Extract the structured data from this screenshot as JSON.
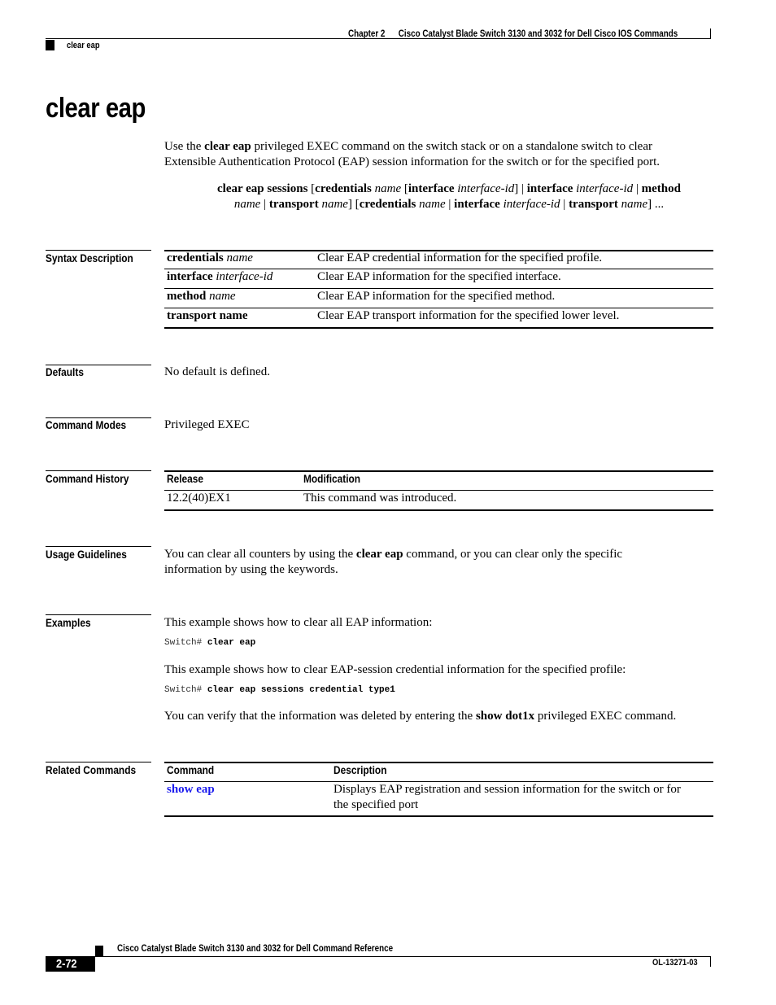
{
  "header": {
    "chapter": "Chapter 2",
    "book_section": "Cisco Catalyst Blade Switch 3130 and 3032 for Dell Cisco IOS Commands",
    "running_head": "clear eap"
  },
  "title": "clear eap",
  "intro": {
    "pre": "Use the ",
    "cmd": "clear eap",
    "post1": " privileged EXEC command on the switch stack or on a standalone switch to clear",
    "line2": "Extensible Authentication Protocol (EAP) session information for the switch or for the specified port."
  },
  "syntax": {
    "l1": [
      {
        "t": "clear eap sessions",
        "s": "b"
      },
      {
        "t": " [",
        "s": "n"
      },
      {
        "t": "credentials",
        "s": "b"
      },
      {
        "t": " name",
        "s": "i"
      },
      {
        "t": " [",
        "s": "n"
      },
      {
        "t": "interface",
        "s": "b"
      },
      {
        "t": " interface-id",
        "s": "i"
      },
      {
        "t": "] | ",
        "s": "n"
      },
      {
        "t": "interface",
        "s": "b"
      },
      {
        "t": " interface-id",
        "s": "i"
      },
      {
        "t": " | ",
        "s": "n"
      },
      {
        "t": "method",
        "s": "b"
      }
    ],
    "l2": [
      {
        "t": "name",
        "s": "i"
      },
      {
        "t": " | ",
        "s": "n"
      },
      {
        "t": "transport",
        "s": "b"
      },
      {
        "t": " name",
        "s": "i"
      },
      {
        "t": "] [",
        "s": "n"
      },
      {
        "t": "credentials",
        "s": "b"
      },
      {
        "t": " name",
        "s": "i"
      },
      {
        "t": " | ",
        "s": "n"
      },
      {
        "t": "interface",
        "s": "b"
      },
      {
        "t": " interface-id",
        "s": "i"
      },
      {
        "t": " | ",
        "s": "n"
      },
      {
        "t": "transport",
        "s": "b"
      },
      {
        "t": " name",
        "s": "i"
      },
      {
        "t": "] ...",
        "s": "n"
      }
    ]
  },
  "sections": {
    "syntax_description": "Syntax Description",
    "defaults": "Defaults",
    "command_modes": "Command Modes",
    "command_history": "Command History",
    "usage_guidelines": "Usage Guidelines",
    "examples": "Examples",
    "related_commands": "Related Commands"
  },
  "syntax_table": [
    {
      "kw": "credentials",
      "arg": " name",
      "desc": "Clear EAP credential information for the specified profile."
    },
    {
      "kw": "interface",
      "arg": " interface-id",
      "desc": "Clear EAP information for the specified interface."
    },
    {
      "kw": "method",
      "arg": " name",
      "desc": "Clear EAP information for the specified method."
    },
    {
      "kw": "transport name",
      "arg": "",
      "desc": "Clear EAP transport information for the specified lower level."
    }
  ],
  "defaults_text": "No default is defined.",
  "command_modes_text": "Privileged EXEC",
  "history": {
    "headers": [
      "Release",
      "Modification"
    ],
    "rows": [
      [
        "12.2(40)EX1",
        "This command was introduced."
      ]
    ]
  },
  "usage": {
    "pre": "You can clear all counters by using the ",
    "cmd": "clear eap",
    "post": " command, or you can clear only the specific",
    "line2": "information by using the keywords."
  },
  "examples": {
    "ex1_text": "This example shows how to clear all EAP information:",
    "ex1_prompt": "Switch# ",
    "ex1_cmd": "clear eap",
    "ex2_text": "This example shows how to clear EAP-session credential information for the specified profile:",
    "ex2_prompt": "Switch# ",
    "ex2_cmd": "clear eap sessions credential type1",
    "verify_pre": "You can verify that the information was deleted by entering the ",
    "verify_cmd": "show dot1x",
    "verify_post": " privileged EXEC command."
  },
  "related": {
    "headers": [
      "Command",
      "Description"
    ],
    "rows": [
      {
        "cmd": "show eap",
        "desc1": "Displays EAP registration and session information for the switch or for",
        "desc2": "the specified port"
      }
    ]
  },
  "footer": {
    "book_title": "Cisco Catalyst Blade Switch 3130 and 3032 for Dell Command Reference",
    "page_number": "2-72",
    "doc_id": "OL-13271-03"
  },
  "colors": {
    "link": "#1a1aee",
    "text": "#000000"
  }
}
